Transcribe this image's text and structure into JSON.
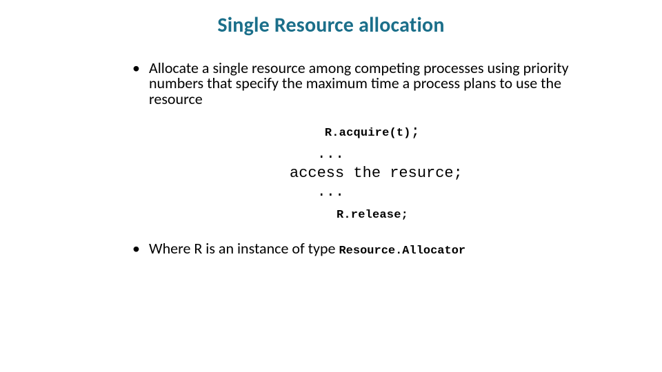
{
  "title": "Single Resource allocation",
  "bullet1": "Allocate a single resource among competing processes using priority numbers that specify the maximum time a process  plans to use the resource",
  "code": {
    "acquire_mono": "R.acquire(t)",
    "acquire_semi": ";",
    "mid": "   ...\naccess the resurce;\n   ...",
    "release": "R.release;"
  },
  "bullet2_prefix": "Where R is an instance of  type ",
  "bullet2_code": "Resource.Allocator"
}
